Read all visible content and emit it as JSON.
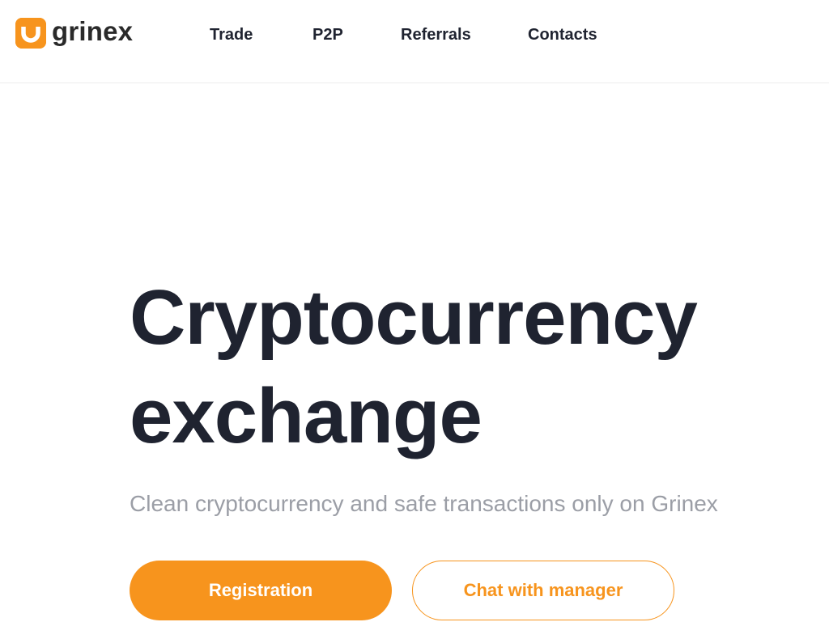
{
  "header": {
    "logo": {
      "text": "grinex",
      "icon": "grinex-logo-icon"
    },
    "nav": [
      {
        "label": "Trade"
      },
      {
        "label": "P2P"
      },
      {
        "label": "Referrals"
      },
      {
        "label": "Contacts"
      }
    ]
  },
  "hero": {
    "title_line1": "Cryptocurrency",
    "title_line2": "exchange",
    "subtitle": "Clean cryptocurrency and safe transactions only on Grinex",
    "primary_button": "Registration",
    "secondary_button": "Chat with manager"
  },
  "colors": {
    "accent": "#f7941d",
    "text_dark": "#1f2330",
    "text_muted": "#9b9ea6"
  }
}
